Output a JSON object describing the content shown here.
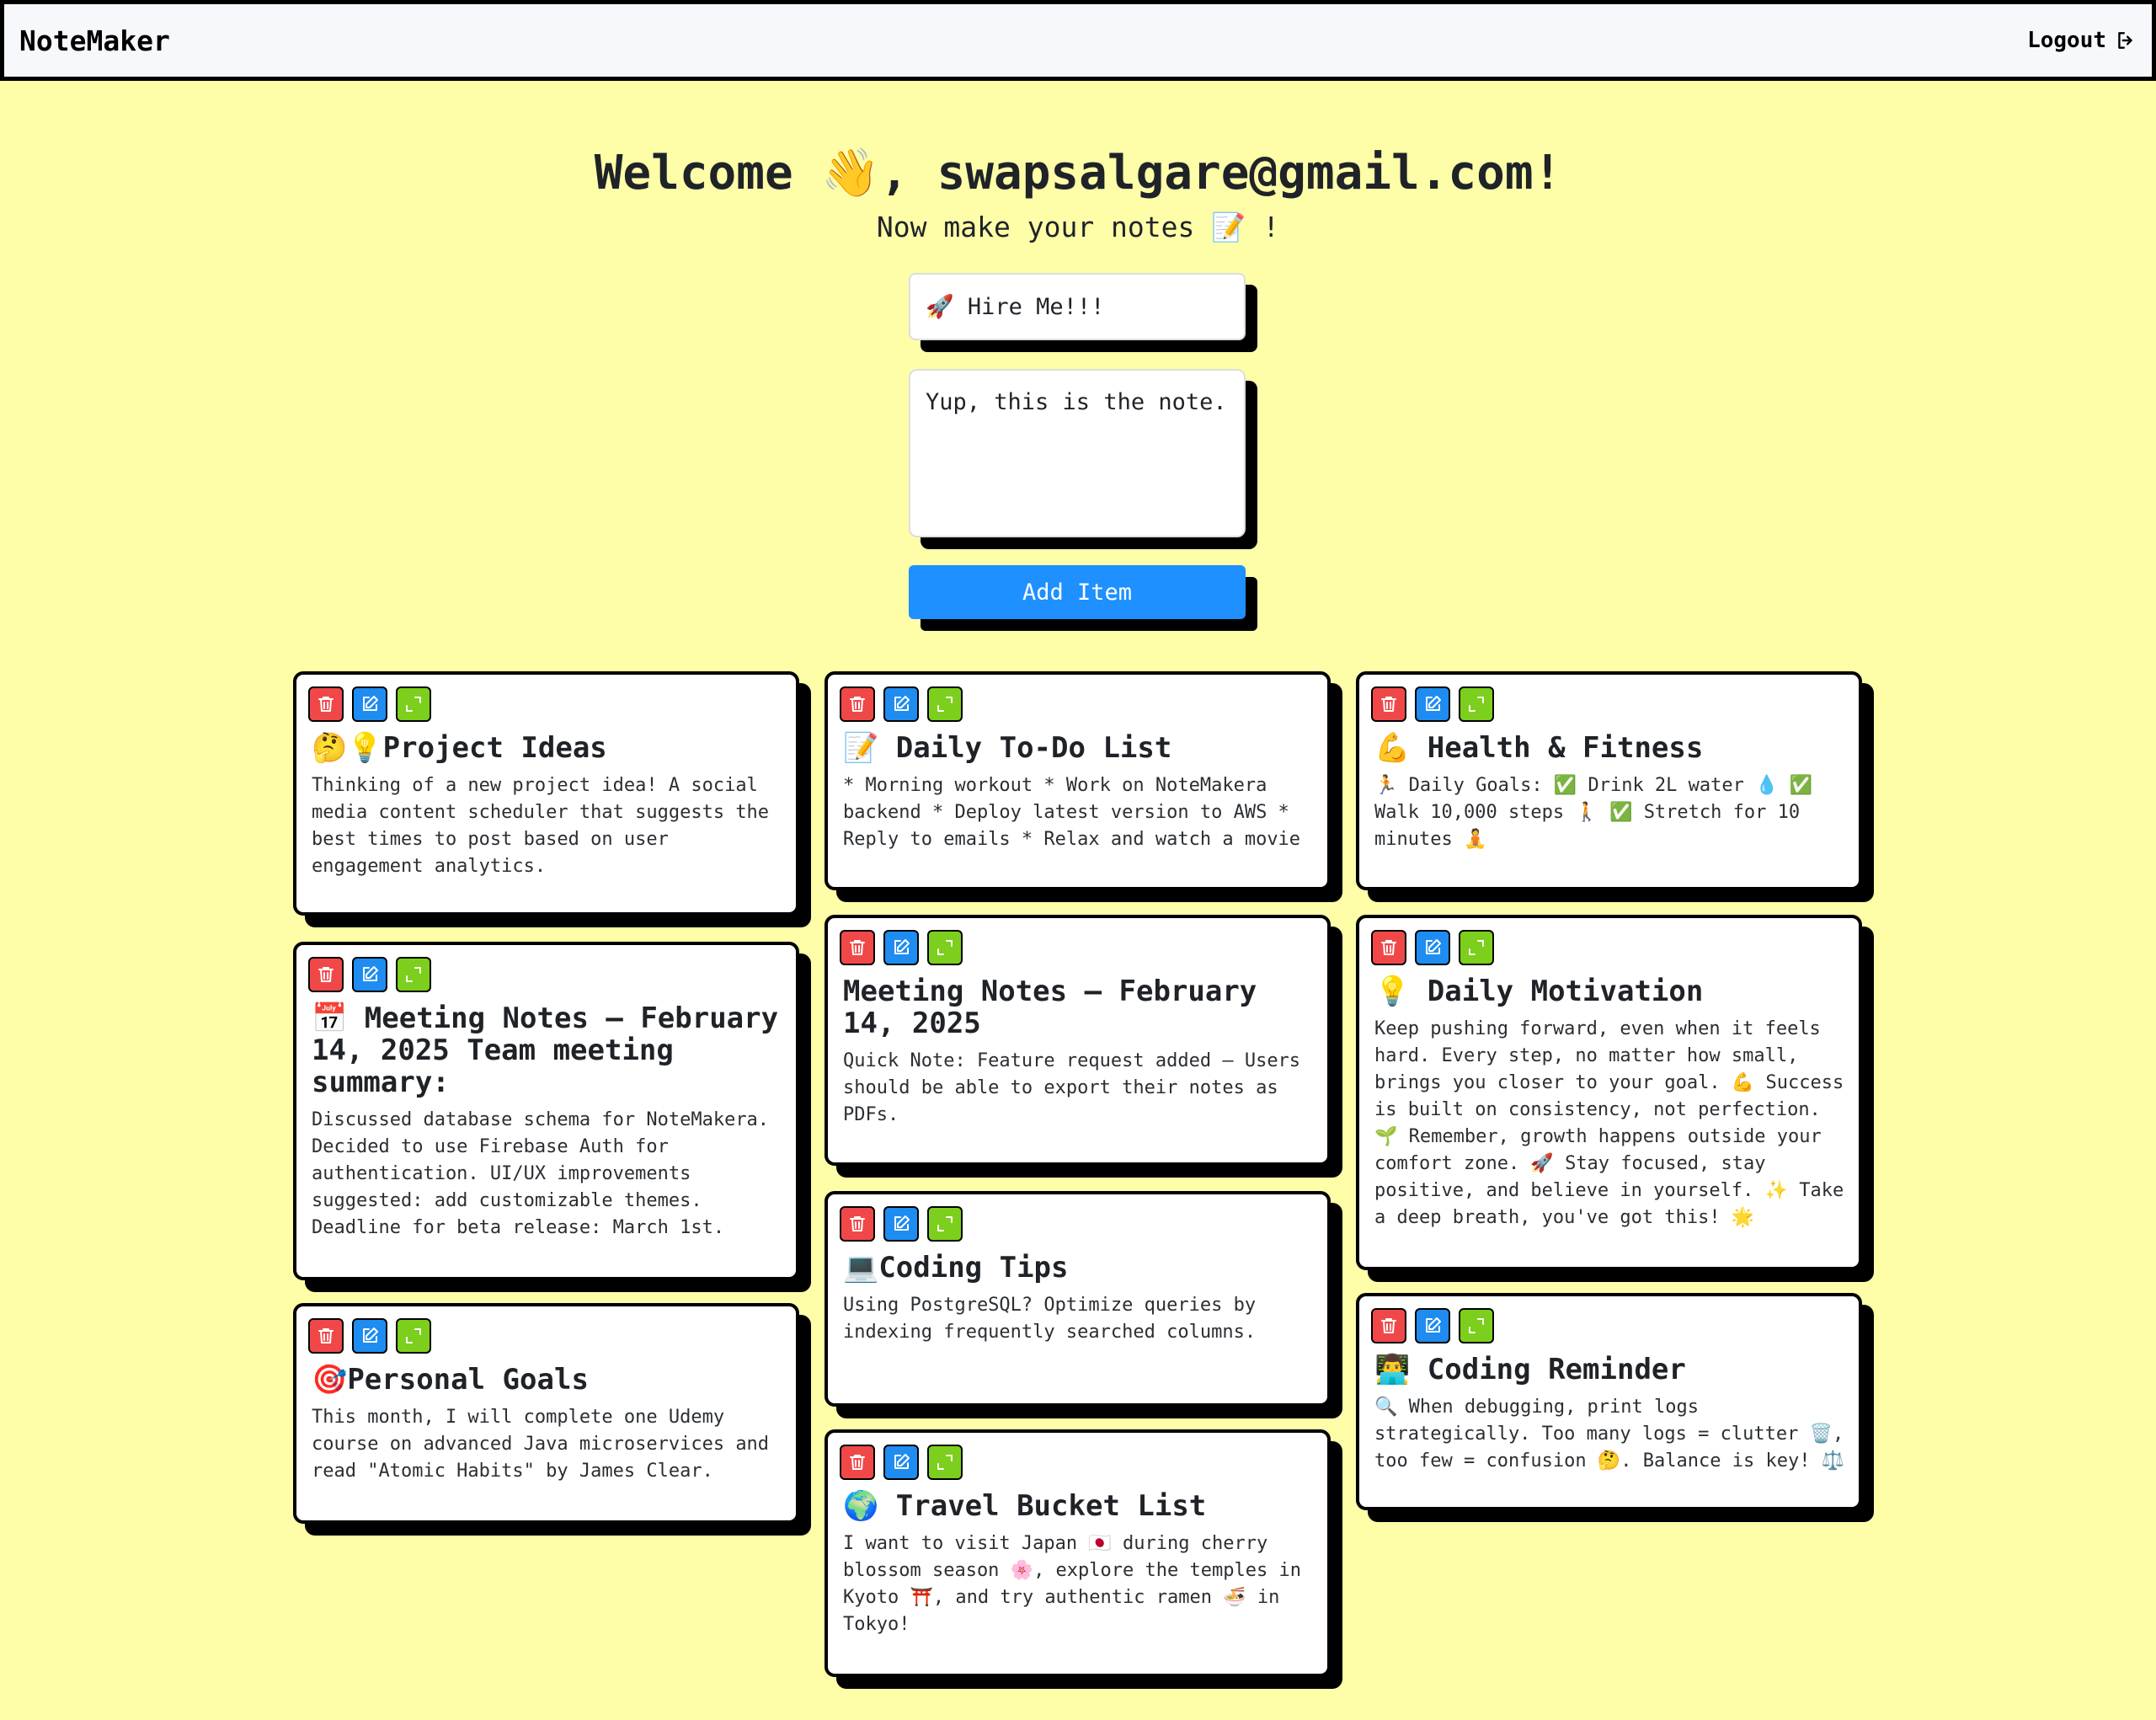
{
  "nav": {
    "brand": "NoteMaker",
    "logout_label": "Logout"
  },
  "welcome": {
    "heading": "Welcome 👋, swapsalgare@gmail.com!",
    "subtitle": "Now make your notes 📝 !"
  },
  "form": {
    "title_value": "🚀 Hire Me!!!",
    "content_value": "Yup, this is the note.",
    "add_label": "Add Item"
  },
  "colors": {
    "background": "#fefda8",
    "delete": "#f04848",
    "edit": "#1e8cf0",
    "expand": "#7ccf1c",
    "add_button": "#1e90ff"
  },
  "icons": {
    "delete": "trash-icon",
    "edit": "edit-icon",
    "expand": "expand-icon",
    "logout": "logout-icon"
  },
  "notes": [
    {
      "title": "🤔💡Project Ideas",
      "content": "Thinking of a new project idea! A social media content scheduler that suggests the best times to post based on user engagement analytics."
    },
    {
      "title": "📅 Meeting Notes – February 14, 2025 Team meeting summary:",
      "content": "Discussed database schema for NoteMakera. Decided to use Firebase Auth for authentication. UI/UX improvements suggested: add customizable themes. Deadline for beta release: March 1st."
    },
    {
      "title": "🎯Personal Goals",
      "content": "This month, I will complete one Udemy course on advanced Java microservices and read \"Atomic Habits\" by James Clear."
    },
    {
      "title": "📝 Daily To-Do List",
      "content": "* Morning workout * Work on NoteMakera backend * Deploy latest version to AWS * Reply to emails * Relax and watch a movie"
    },
    {
      "title": "Meeting Notes – February 14, 2025",
      "content": "Quick Note: Feature request added – Users should be able to export their notes as PDFs."
    },
    {
      "title": "💻Coding Tips",
      "content": "Using PostgreSQL? Optimize queries by indexing frequently searched columns."
    },
    {
      "title": "🌍 Travel Bucket List",
      "content": "I want to visit Japan 🇯🇵 during cherry blossom season 🌸, explore the temples in Kyoto ⛩️, and try authentic ramen 🍜 in Tokyo!"
    },
    {
      "title": "💪 Health & Fitness",
      "content": "🏃 Daily Goals: ✅ Drink 2L water 💧 ✅ Walk 10,000 steps 🚶 ✅ Stretch for 10 minutes 🧘"
    },
    {
      "title": "💡 Daily Motivation",
      "content": "Keep pushing forward, even when it feels hard. Every step, no matter how small, brings you closer to your goal. 💪 Success is built on consistency, not perfection. 🌱 Remember, growth happens outside your comfort zone. 🚀 Stay focused, stay positive, and believe in yourself. ✨ Take a deep breath, you've got this! 🌟"
    },
    {
      "title": "👨‍💻 Coding Reminder",
      "content": "🔍 When debugging, print logs strategically. Too many logs = clutter 🗑️, too few = confusion 🤔. Balance is key! ⚖️"
    }
  ]
}
